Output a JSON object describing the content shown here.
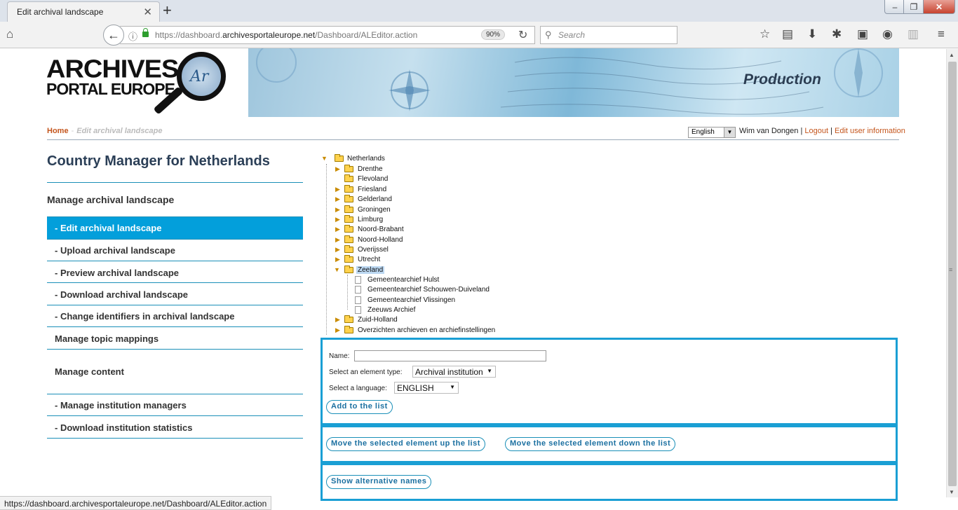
{
  "browser": {
    "tab_title": "Edit archival landscape",
    "tab_close": "✕",
    "new_tab": "+",
    "url_prefix": "https://dashboard.",
    "url_domain": "archivesportaleurope.net",
    "url_path": "/Dashboard/ALEditor.action",
    "zoom": "90%",
    "search_placeholder": "Search",
    "status_url": "https://dashboard.archivesportaleurope.net/Dashboard/ALEditor.action",
    "win_min": "‒",
    "win_max": "❐",
    "win_close": "✕"
  },
  "logo": {
    "line1": "ARCHIVES",
    "line2": "PORTAL EUROPE",
    "mark": "Ar"
  },
  "banner": {
    "title": "Production"
  },
  "breadcrumb": {
    "home": "Home",
    "separator": "-",
    "current": "Edit archival landscape"
  },
  "user_bar": {
    "language": "English",
    "user": "Wim van Dongen",
    "sep": "|",
    "logout": "Logout",
    "edit_user": "Edit user information"
  },
  "sidebar": {
    "title": "Country Manager for Netherlands",
    "section1": "Manage archival landscape",
    "items": [
      {
        "label": "- Edit archival landscape",
        "active": true
      },
      {
        "label": "- Upload archival landscape",
        "active": false
      },
      {
        "label": "- Preview archival landscape",
        "active": false
      },
      {
        "label": "- Download archival landscape",
        "active": false
      },
      {
        "label": "- Change identifiers in archival landscape",
        "active": false
      }
    ],
    "topic_mappings": "Manage topic mappings",
    "section2": "Manage content",
    "items2": [
      {
        "label": "- Manage institution managers"
      },
      {
        "label": "- Download institution statistics"
      }
    ]
  },
  "tree": {
    "root": "Netherlands",
    "provinces": [
      "Drenthe",
      "Flevoland",
      "Friesland",
      "Gelderland",
      "Groningen",
      "Limburg",
      "Noord-Brabant",
      "Noord-Holland",
      "Overijssel",
      "Utrecht"
    ],
    "selected": "Zeeland",
    "zeeland_children": [
      "Gemeentearchief Hulst",
      "Gemeentearchief Schouwen-Duiveland",
      "Gemeentearchief Vlissingen",
      "Zeeuws Archief"
    ],
    "after": [
      "Zuid-Holland",
      "Overzichten archieven en archiefinstellingen"
    ]
  },
  "form": {
    "name_label": "Name:",
    "name_value": "",
    "type_label": "Select an element type:",
    "type_value": "Archival institution",
    "lang_label": "Select a language:",
    "lang_value": "ENGLISH",
    "add_button": "Add to the list",
    "move_up_button": "Move the selected element up the list",
    "move_down_button": "Move the selected element down the list",
    "alt_names_button": "Show alternative names"
  },
  "colors": {
    "accent": "#039fdb",
    "link": "#c4551c",
    "heading": "#2b3f57",
    "panel_border": "#1a9fd4"
  }
}
